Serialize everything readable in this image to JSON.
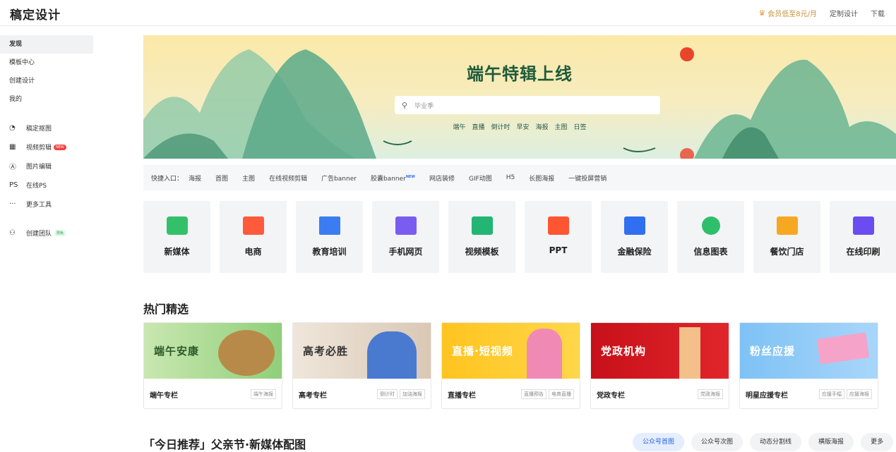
{
  "header": {
    "logo": "稿定设计",
    "vip": "会员低至8元/月",
    "custom": "定制设计",
    "download": "下载"
  },
  "sidebar": {
    "items": [
      {
        "label": "发现"
      },
      {
        "label": "模板中心"
      },
      {
        "label": "创建设计"
      },
      {
        "label": "我的"
      }
    ],
    "tools": [
      {
        "label": "稿定抠图",
        "icon": "cutout-icon"
      },
      {
        "label": "视频剪辑",
        "icon": "film-icon",
        "badge": "NEW"
      },
      {
        "label": "图片编辑",
        "icon": "pen-icon"
      },
      {
        "label": "在线PS",
        "icon": "ps-icon"
      },
      {
        "label": "更多工具",
        "icon": "more-icon"
      }
    ],
    "team": {
      "label": "创建团队",
      "badge": "限免"
    }
  },
  "banner": {
    "title": "端午特辑上线",
    "search_placeholder": "毕业季",
    "tags": [
      "端午",
      "直播",
      "倒计时",
      "早安",
      "海报",
      "主图",
      "日签"
    ]
  },
  "quick": {
    "label": "快捷入口：",
    "links": [
      "海报",
      "首图",
      "主图",
      "在线视频剪辑",
      "广告banner",
      "胶囊banner",
      "网店装修",
      "GIF动图",
      "H5",
      "长图海报",
      "一键投屏营销"
    ],
    "new_sup": "NEW"
  },
  "categories": [
    {
      "label": "新媒体",
      "color": "#34c06a"
    },
    {
      "label": "电商",
      "color": "#ff5a3c"
    },
    {
      "label": "教育培训",
      "color": "#3b7cf0"
    },
    {
      "label": "手机网页",
      "color": "#7a5cf0"
    },
    {
      "label": "视频模板",
      "color": "#22b573"
    },
    {
      "label": "PPT",
      "color": "#ff5533"
    },
    {
      "label": "金融保险",
      "color": "#2f6ff0"
    },
    {
      "label": "信息图表",
      "color": "#2fbf6a"
    },
    {
      "label": "餐饮门店",
      "color": "#f7a823"
    },
    {
      "label": "在线印刷",
      "color": "#6b4cf0"
    }
  ],
  "hot": {
    "title": "热门精选",
    "cards": [
      {
        "image_text": "端午安康",
        "name": "端午专栏",
        "tags": [
          "端午海报"
        ]
      },
      {
        "image_text": "高考必胜",
        "name": "高考专栏",
        "tags": [
          "倒计时",
          "加油海报"
        ]
      },
      {
        "image_text": "直播·短视频",
        "name": "直播专栏",
        "tags": [
          "直播预告",
          "电商直播"
        ]
      },
      {
        "image_text": "党政机构",
        "name": "党政专栏",
        "tags": [
          "党政海报"
        ]
      },
      {
        "image_text": "粉丝应援",
        "name": "明星应援专栏",
        "tags": [
          "应援手幅",
          "应援海报"
        ]
      }
    ]
  },
  "recommend": {
    "title": "「今日推荐」父亲节·新媒体配图",
    "tabs": [
      "公众号首图",
      "公众号次图",
      "动态分割线",
      "横版海报",
      "更多"
    ]
  }
}
